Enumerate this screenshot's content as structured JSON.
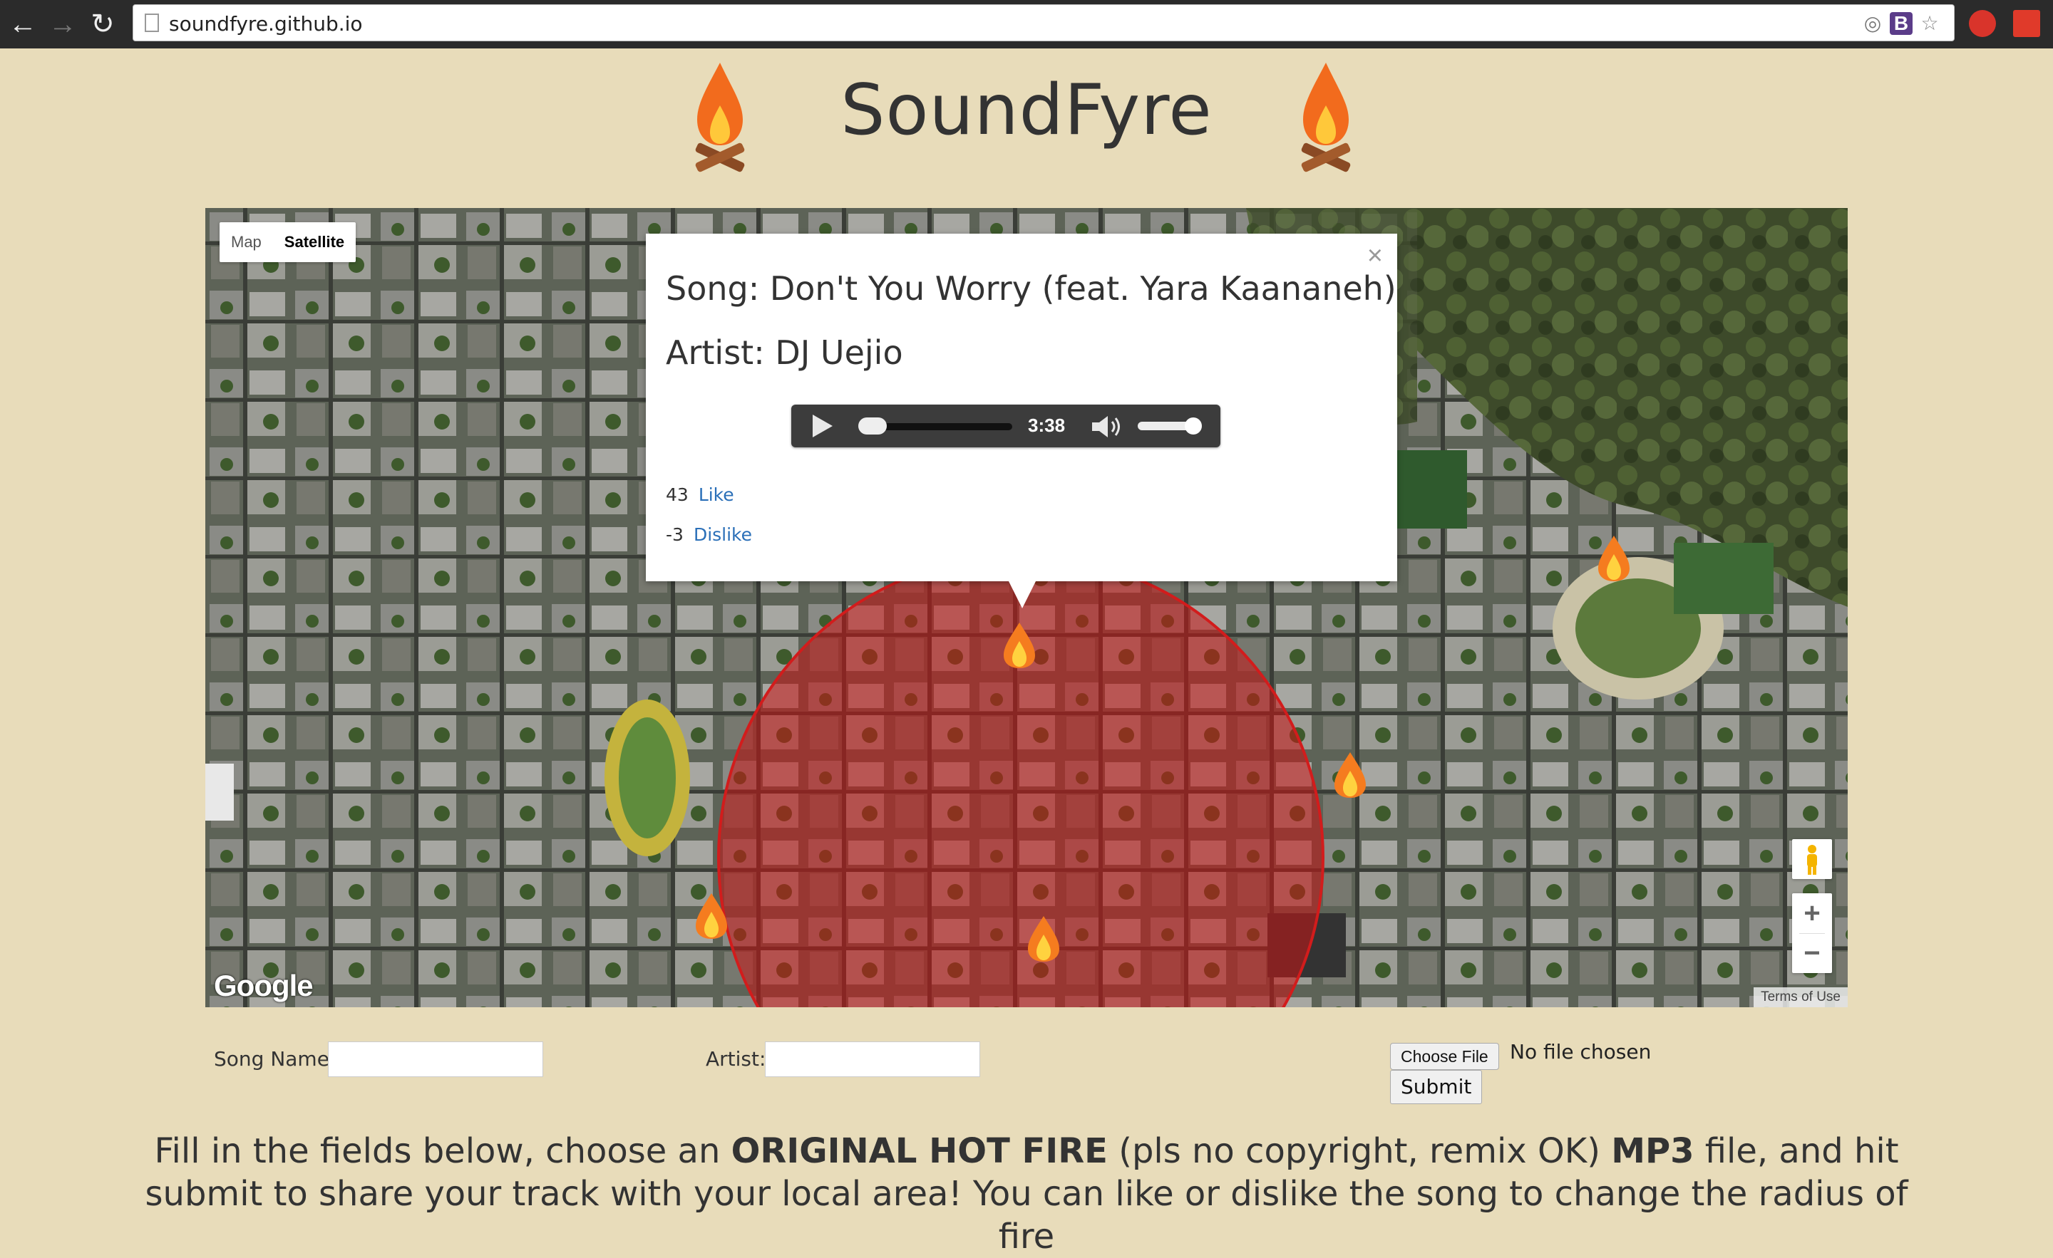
{
  "browser": {
    "url": "soundfyre.github.io",
    "back_icon": "back-arrow-icon",
    "forward_icon": "forward-arrow-icon",
    "reload_icon": "reload-icon"
  },
  "header": {
    "title": "SoundFyre"
  },
  "map": {
    "type_controls": [
      "Map",
      "Satellite"
    ],
    "active_type": "Satellite",
    "zoom_in_label": "+",
    "zoom_out_label": "−",
    "google_label": "Google",
    "terms_label": "Terms of Use",
    "circle_color": "#d21c1c"
  },
  "infowindow": {
    "close_label": "×",
    "song": "Song: Don't You Worry (feat. Yara Kaananeh)",
    "artist": "Artist: DJ Uejio",
    "player": {
      "time": "3:38"
    },
    "likes": "43",
    "like_label": "Like",
    "dislikes": "-3",
    "dislike_label": "Dislike"
  },
  "form": {
    "song_label": "Song Name:",
    "artist_label": "Artist:",
    "song_value": "",
    "artist_value": "",
    "choose_file_label": "Choose File",
    "no_file_text": "No file chosen",
    "submit_label": "Submit"
  },
  "instructions": {
    "part1": "Fill in the fields below, choose an ",
    "bold1": "ORIGINAL HOT FIRE",
    "part2": " (pls no copyright, remix OK) ",
    "bold2": "MP3",
    "part3": " file, and hit",
    "line2": "submit to share your track with your local area! You can like or dislike the song to change the radius of fire"
  },
  "colors": {
    "page_bg": "#e8dcba",
    "link": "#2a6fb8"
  }
}
